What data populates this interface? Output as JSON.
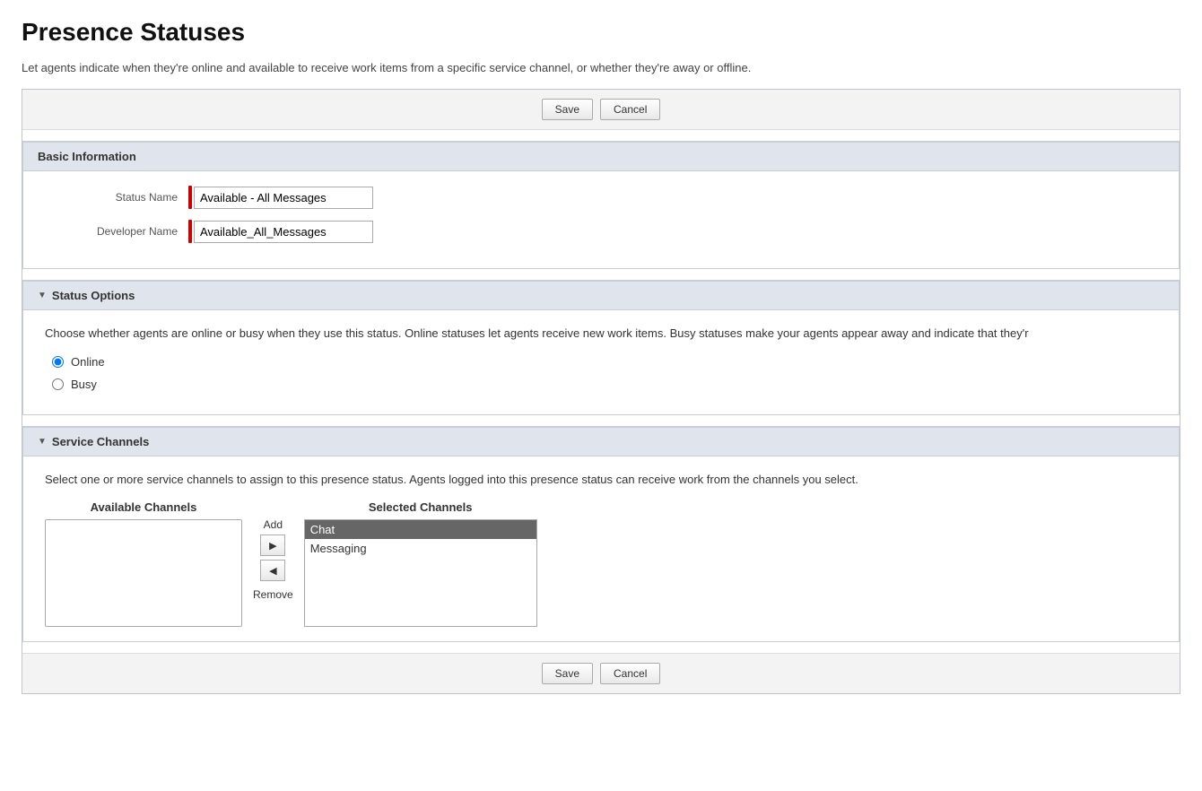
{
  "page": {
    "title": "Presence Statuses",
    "description": "Let agents indicate when they're online and available to receive work items from a specific service channel, or whether they're away or offline."
  },
  "toolbar": {
    "save_label": "Save",
    "cancel_label": "Cancel"
  },
  "basic_info": {
    "section_label": "Basic Information",
    "status_name_label": "Status Name",
    "status_name_value": "Available - All Messages",
    "developer_name_label": "Developer Name",
    "developer_name_value": "Available_All_Messages"
  },
  "status_options": {
    "section_label": "Status Options",
    "description": "Choose whether agents are online or busy when they use this status. Online statuses let agents receive new work items. Busy statuses make your agents appear away and indicate that they'r",
    "options": [
      {
        "label": "Online",
        "checked": true
      },
      {
        "label": "Busy",
        "checked": false
      }
    ]
  },
  "service_channels": {
    "section_label": "Service Channels",
    "description": "Select one or more service channels to assign to this presence status. Agents logged into this presence status can receive work from the channels you select.",
    "available_channels_label": "Available Channels",
    "selected_channels_label": "Selected Channels",
    "add_label": "Add",
    "remove_label": "Remove",
    "available_items": [],
    "selected_items": [
      {
        "label": "Chat",
        "highlighted": true
      },
      {
        "label": "Messaging",
        "highlighted": false
      }
    ]
  },
  "icons": {
    "arrow_down": "▼",
    "arrow_right": "▶",
    "arrow_left": "◀"
  }
}
